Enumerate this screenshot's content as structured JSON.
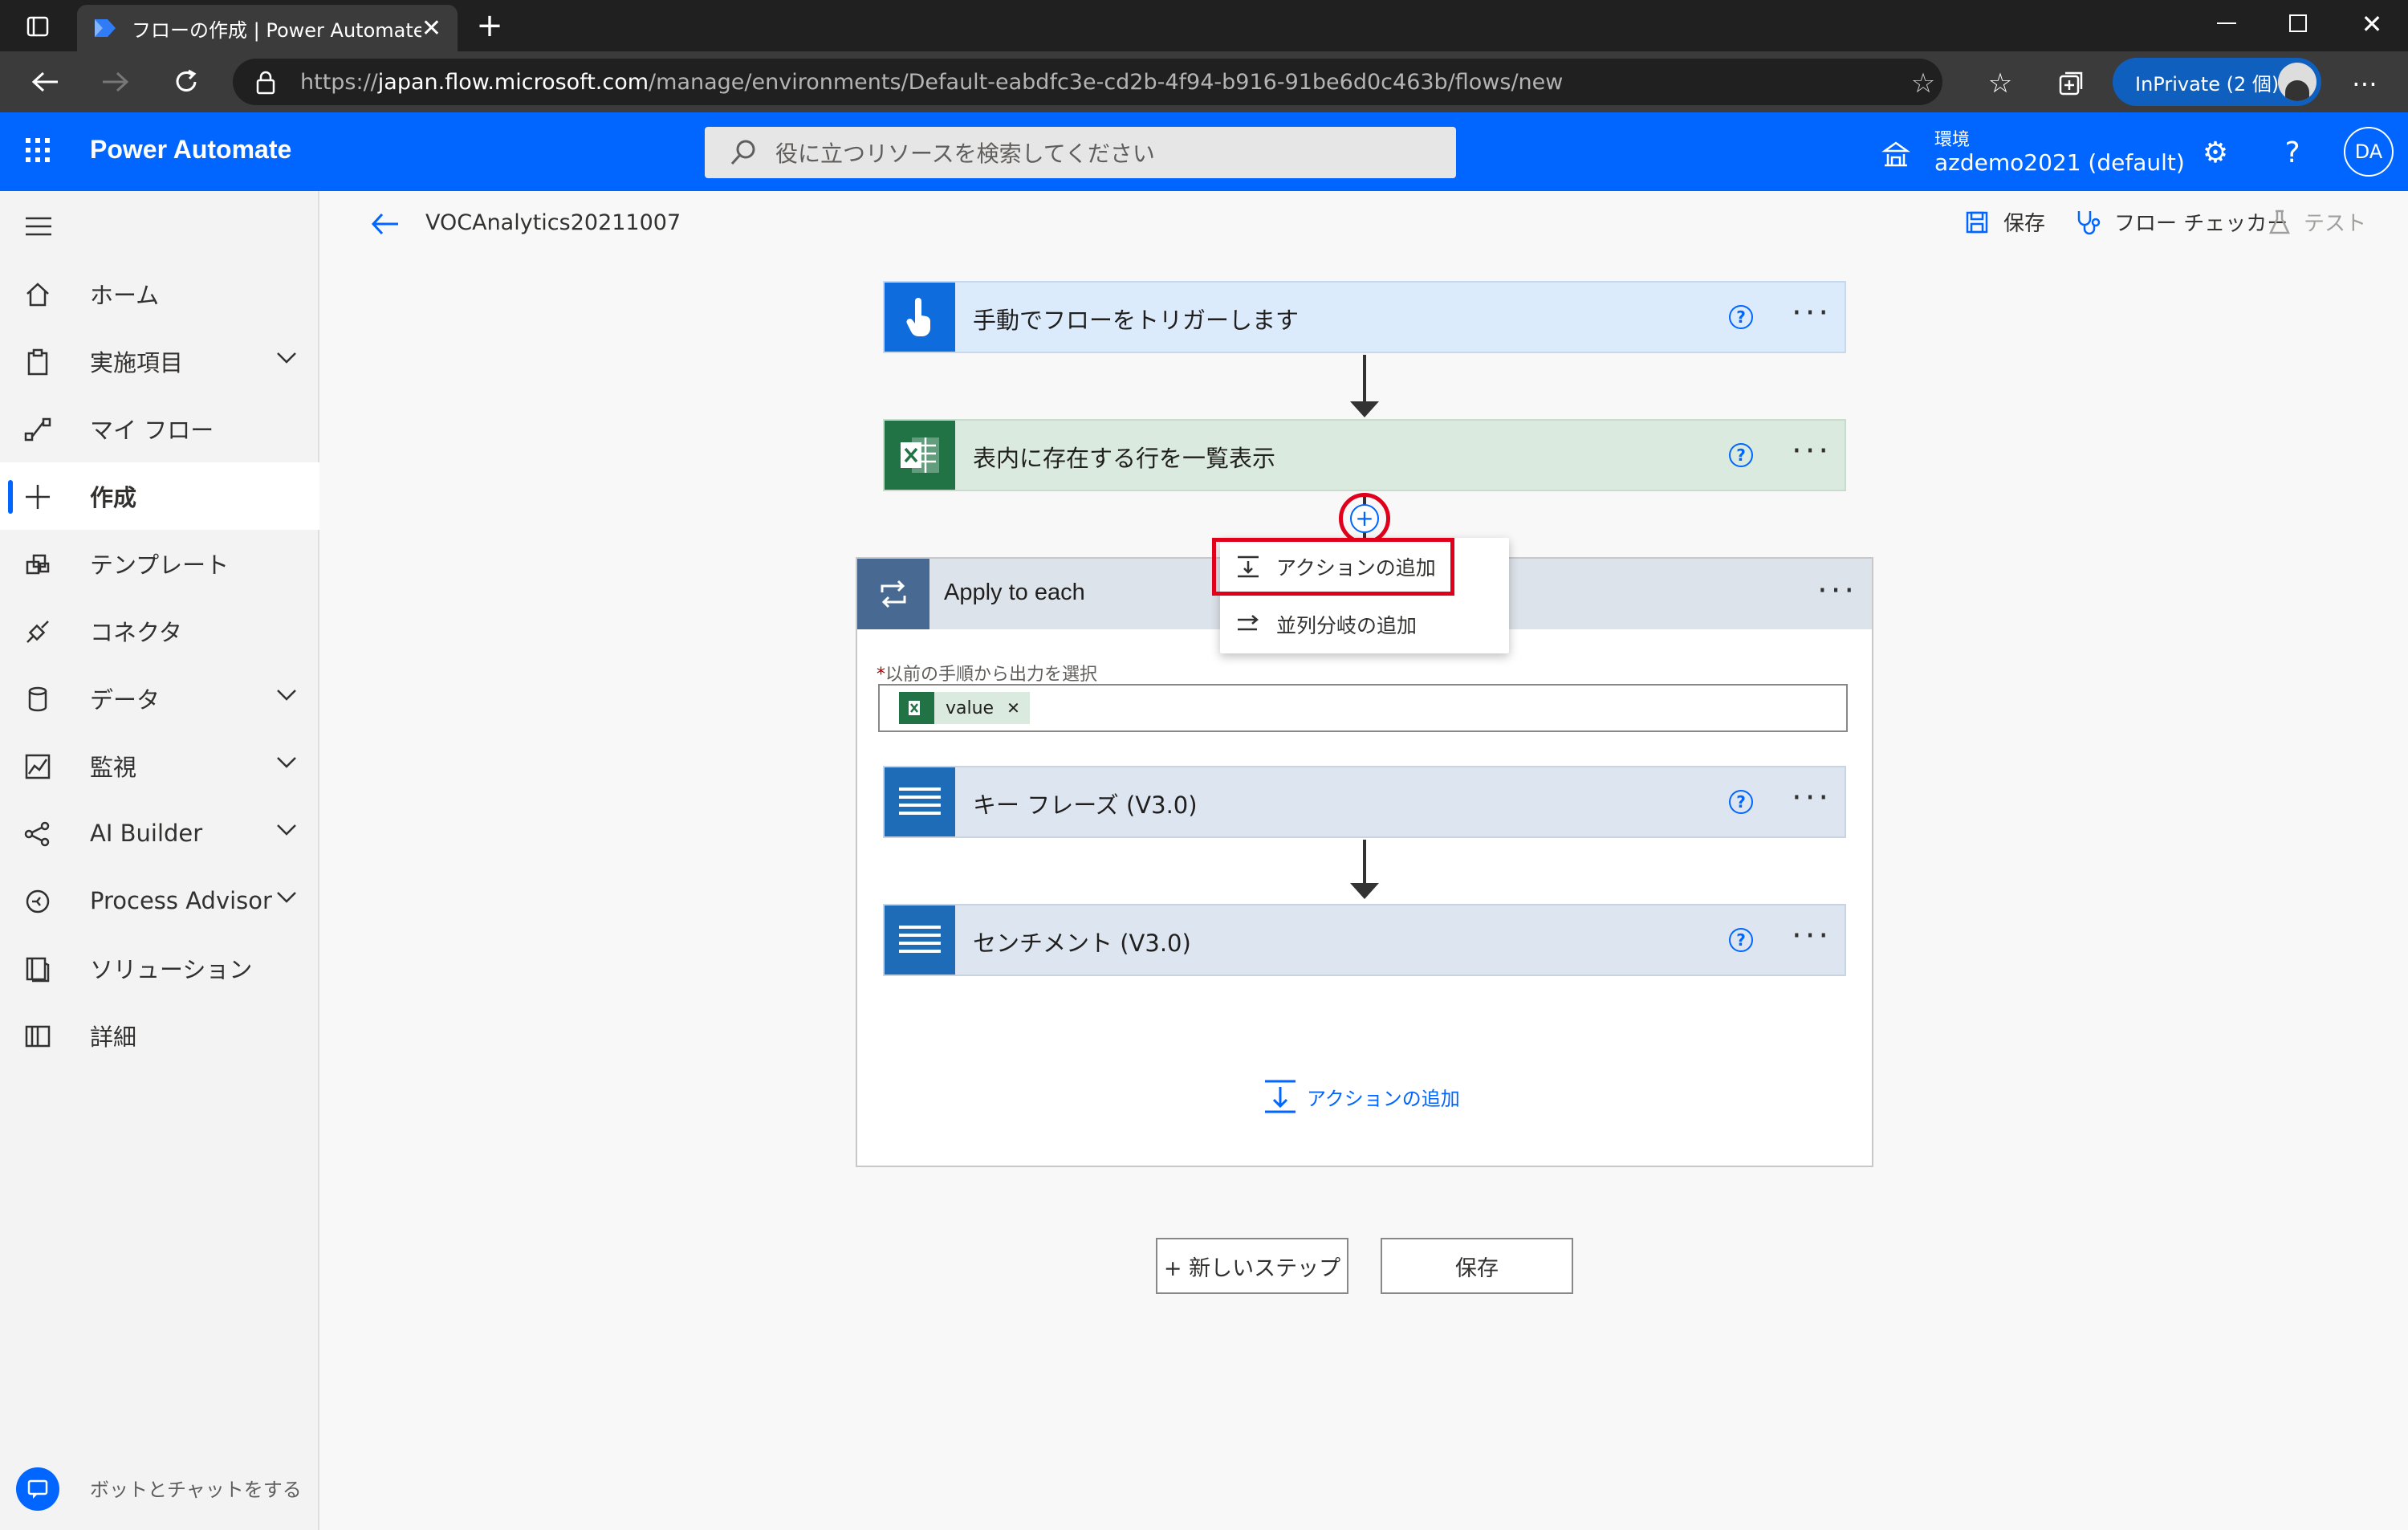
{
  "browser": {
    "tab_title": "フローの作成 | Power Automate",
    "url_prefix": "https://",
    "url_host": "japan.flow.microsoft.com",
    "url_path": "/manage/environments/Default-eabdfc3e-cd2b-4f94-b916-91be6d0c463b/flows/new",
    "inprivate_label": "InPrivate (2 個)"
  },
  "header": {
    "app_name": "Power Automate",
    "search_placeholder": "役に立つリソースを検索してください",
    "env_label": "環境",
    "env_value": "azdemo2021 (default)",
    "avatar_initials": "DA"
  },
  "sidebar": {
    "items": [
      {
        "label": "ホーム"
      },
      {
        "label": "実施項目"
      },
      {
        "label": "マイ フロー"
      },
      {
        "label": "作成"
      },
      {
        "label": "テンプレート"
      },
      {
        "label": "コネクタ"
      },
      {
        "label": "データ"
      },
      {
        "label": "監視"
      },
      {
        "label": "AI Builder"
      },
      {
        "label": "Process Advisor"
      },
      {
        "label": "ソリューション"
      },
      {
        "label": "詳細"
      }
    ],
    "chat_label": "ボットとチャットをする"
  },
  "command_bar": {
    "flow_name": "VOCAnalytics20211007",
    "save": "保存",
    "checker": "フロー チェッカー",
    "test": "テスト"
  },
  "flow": {
    "trigger_title": "手動でフローをトリガーします",
    "excel_title": "表内に存在する行を一覧表示",
    "apply_title": "Apply to each",
    "apply_field_label": "以前の手順から出力を選択",
    "apply_field_token": "value",
    "keyphrase_title": "キー フレーズ (V3.0)",
    "sentiment_title": "センチメント (V3.0)",
    "inner_add_action": "アクションの追加",
    "menu": {
      "add_action": "アクションの追加",
      "add_parallel": "並列分岐の追加"
    },
    "new_step": "+ 新しいステップ",
    "save": "保存"
  }
}
